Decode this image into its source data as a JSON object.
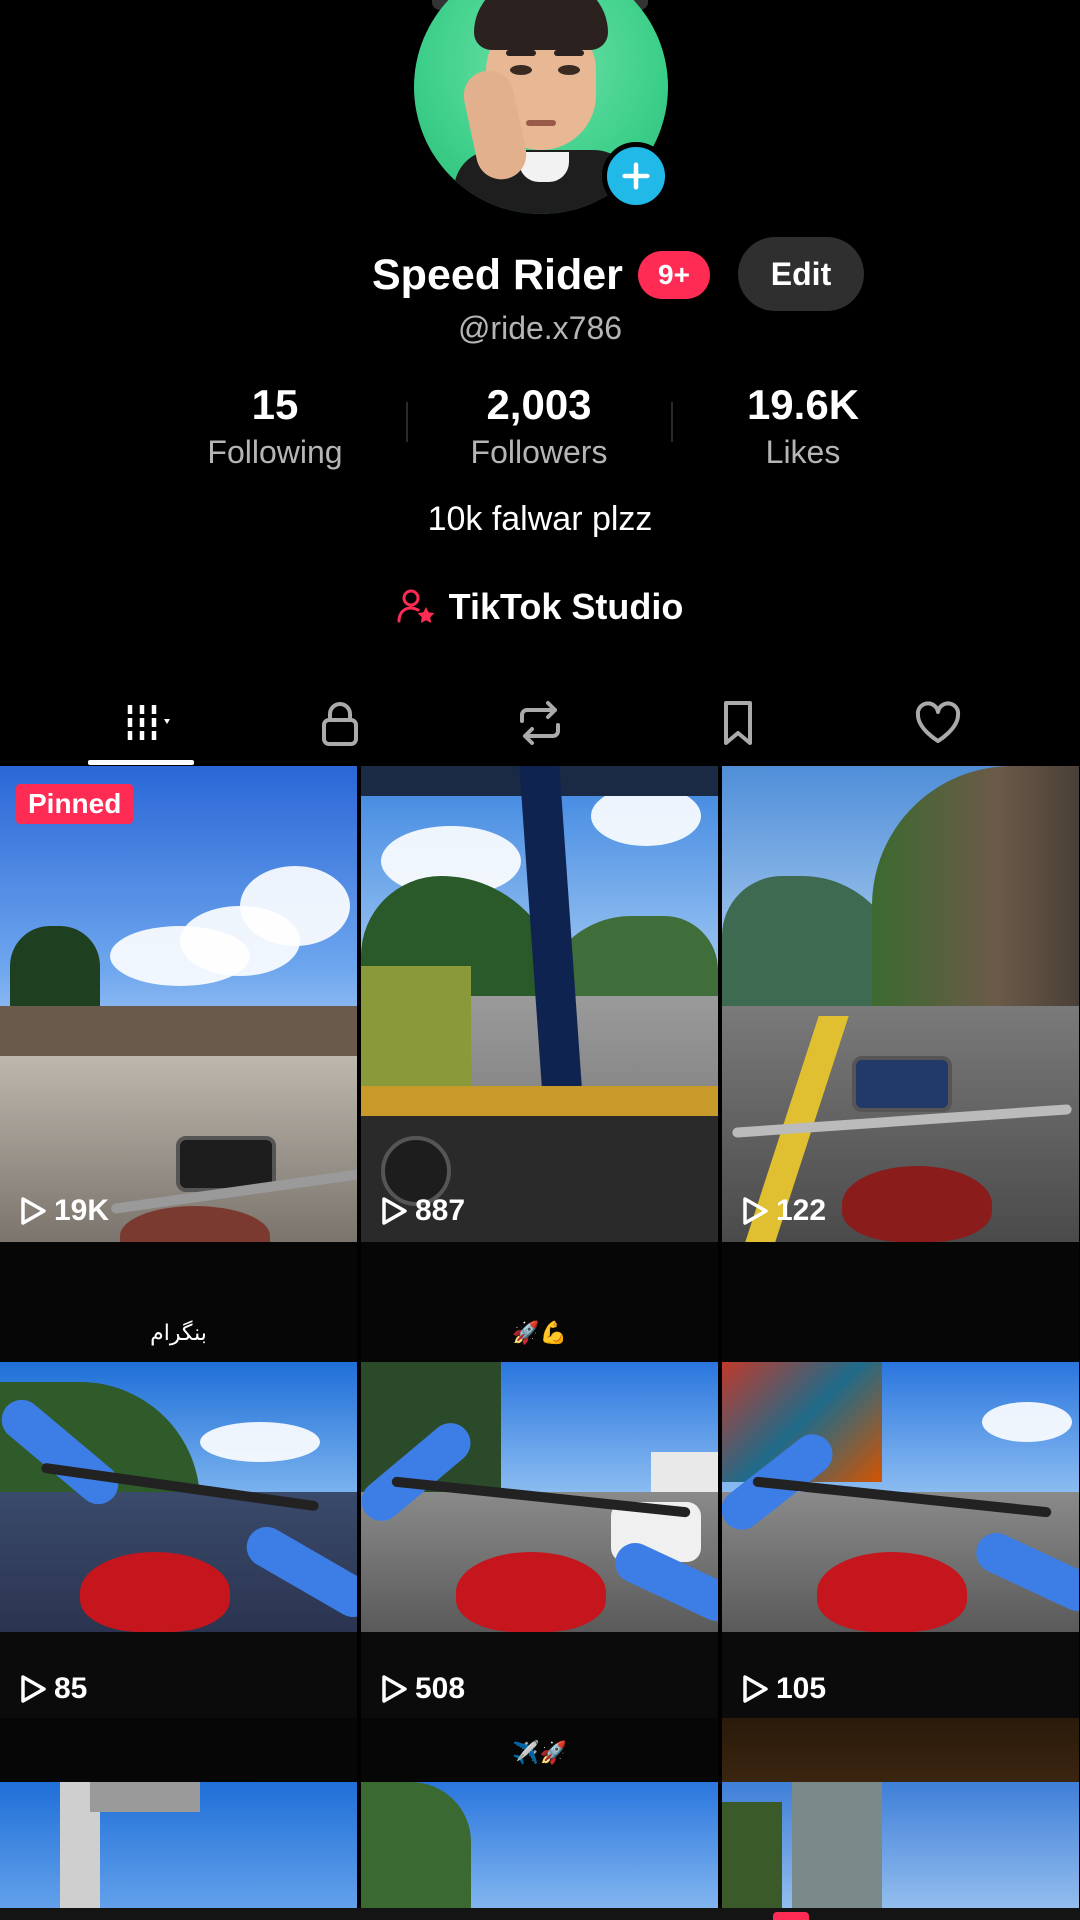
{
  "profile": {
    "display_name": "Speed Rider",
    "notification_badge": "9+",
    "edit_label": "Edit",
    "handle": "@ride.x786",
    "bio": "10k falwar plzz",
    "studio_label": "TikTok Studio"
  },
  "stats": {
    "following": {
      "value": "15",
      "label": "Following"
    },
    "followers": {
      "value": "2,003",
      "label": "Followers"
    },
    "likes": {
      "value": "19.6K",
      "label": "Likes"
    }
  },
  "tabs": [
    {
      "name": "videos",
      "icon": "grid-icon",
      "active": true
    },
    {
      "name": "private",
      "icon": "lock-icon"
    },
    {
      "name": "reposts",
      "icon": "repost-icon"
    },
    {
      "name": "favorites",
      "icon": "bookmark-icon"
    },
    {
      "name": "liked",
      "icon": "heart-icon"
    }
  ],
  "videos": [
    {
      "views": "19K",
      "pinned_label": "Pinned",
      "caption": ""
    },
    {
      "views": "887",
      "caption": ""
    },
    {
      "views": "122",
      "caption": ""
    },
    {
      "views": "85",
      "caption": "بنگرام"
    },
    {
      "views": "508",
      "caption": "🚀💪"
    },
    {
      "views": "105",
      "caption": ""
    },
    {
      "views": "",
      "caption": ""
    },
    {
      "views": "",
      "caption": "✈️🚀"
    },
    {
      "views": "",
      "caption": ""
    }
  ],
  "colors": {
    "accent": "#fe2c55",
    "avatar_plus": "#20b9e8",
    "background": "#000000",
    "muted_text": "#b5b5b5"
  }
}
